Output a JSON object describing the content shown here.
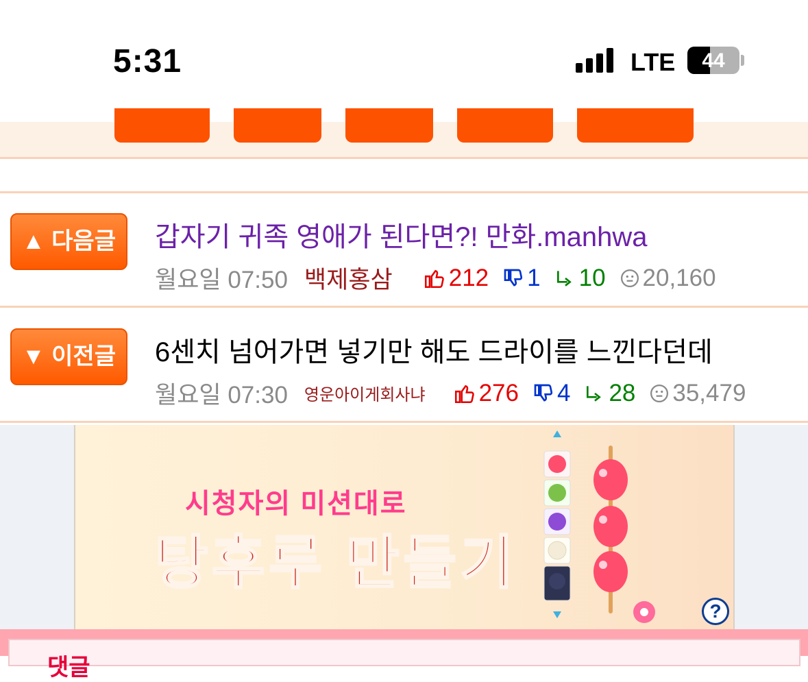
{
  "status_bar": {
    "time": "5:31",
    "network": "LTE",
    "battery": "44"
  },
  "next_post": {
    "button_label": "▲ 다음글",
    "title": "갑자기 귀족 영애가 된다면?! 만화.manhwa",
    "date": "월요일 07:50",
    "author": "백제홍삼",
    "likes": "212",
    "dislikes": "1",
    "replies": "10",
    "views": "20,160",
    "title_color": "#6b21a8"
  },
  "prev_post": {
    "button_label": "▼ 이전글",
    "title": "6센치 넘어가면 넣기만 해도 드라이를 느낀다던데",
    "date": "월요일 07:30",
    "author": "영운아이게회사냐",
    "likes": "276",
    "dislikes": "4",
    "replies": "28",
    "views": "35,479",
    "title_color": "#000000"
  },
  "ad": {
    "subtitle": "시청자의 미션대로",
    "headline": "탕후루 만들기",
    "help_label": "?"
  },
  "comments": {
    "label": "댓글"
  },
  "colors": {
    "accent": "#fd5200",
    "like": "#e60000",
    "dislike": "#0033cc",
    "reply": "#008000"
  }
}
